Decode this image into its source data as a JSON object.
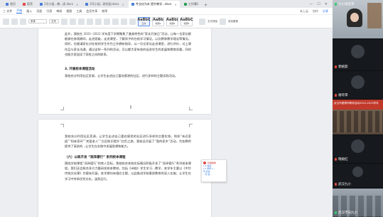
{
  "tabs": [
    {
      "label": "首页",
      "active": false
    },
    {
      "label": "稻壳",
      "active": false
    },
    {
      "label": "1号小组...教...读.docx",
      "active": false
    },
    {
      "label": "2号小组...研究组.docx",
      "active": false
    },
    {
      "label": "专业化为本 提升教学...docx",
      "active": true
    },
    {
      "label": "工作簿1",
      "active": false
    }
  ],
  "menu": {
    "items": [
      "三 文件",
      "开始",
      "插入",
      "页面",
      "引用",
      "审阅",
      "视图",
      "工具",
      "会员专享",
      "效率"
    ],
    "active_index": 1,
    "right": [
      "未上云",
      "协作",
      "分享"
    ]
  },
  "ribbon": {
    "font_name": "宋体",
    "font_size": "五号",
    "styles": [
      {
        "sample": "AaBbC",
        "label": "正文"
      },
      {
        "sample": "AaBb",
        "label": "标题1"
      },
      {
        "sample": "AaBb(",
        "label": "标题2"
      },
      {
        "sample": "AaBbC",
        "label": "标题3"
      }
    ],
    "right_labels": [
      "文字排版",
      "查找替换"
    ]
  },
  "document": {
    "p1": "此外，我校在 2021--2022 学年度下学期聚焦了激具特色的“家长开放日”活动，让每一位家长都能够在参观期间，走进班级，走进课堂，了解孩子的在校学习情况，以及教育教学理念等情况。同时，也邀请家长对在校的学生作为工作拥有指导，以一位位家长走进课堂，进行评价，对上课作品与家长沟通，通过这样一系列的活动，可以都大家有效的促进学生的发展和教育质量，同时也能大家加深了家校之间的联系。",
    "h1": "3. 开展校本课程活动",
    "p2": "我校充分利用社区资源，让学生走进自己喜欢感悉的社区，进行多样的主题实践活动。",
    "p3": "我校充分利用社区资源，让学生走进自己喜欢感悉的社区进行多样的主题实践，例如“亲近家园”“知本家环”“关爱老人”“古旧知识提升“红色之旅，我校还开展了“我的家乡”活动，为各教师提供了高质的...让学生在实践中发展思想和能力。",
    "h2": "（六）以练开发 “润泽德行” 系列校本课程",
    "p4": "围绕学校课程“润泽德行”的育人目标，我校结合本校实际情况积极开发了“润泽德行”系列校本课程。我们还会联合多方力量研发校本教材，包括《诗韵》学生学习...教学，本学年主要以《中华传统文化课》为载体开展，各学期均有相应主题，以此推进学校素质教育的深入实施；让学生在学习中传承优秀文化，涵养品行。"
  },
  "comment": {
    "author": "护理助教",
    "lines": [
      "1.1 加强...",
      "1.1 学研 3 ...",
      "刊 点击...",
      "...写 加..."
    ]
  },
  "participants": [
    {
      "name": "九小张宏英",
      "camera": "person",
      "mic": "on"
    },
    {
      "name": "郭婉茹",
      "camera": "off",
      "mic": "off"
    },
    {
      "name": "谢玲萍",
      "camera": "off",
      "mic": "off"
    },
    {
      "name": "",
      "camera": "room",
      "mic": "on",
      "banner": "武汉市翟桐市教研活动2022-2023学年"
    },
    {
      "name": "晓婉红",
      "camera": "off",
      "mic": "off"
    },
    {
      "name": "武汉九小",
      "camera": "off",
      "mic": "off"
    },
    {
      "name": "武汉市向九小",
      "camera": "classroom",
      "mic": "on"
    }
  ],
  "window_controls": [
    "—",
    "☐",
    "✕"
  ]
}
